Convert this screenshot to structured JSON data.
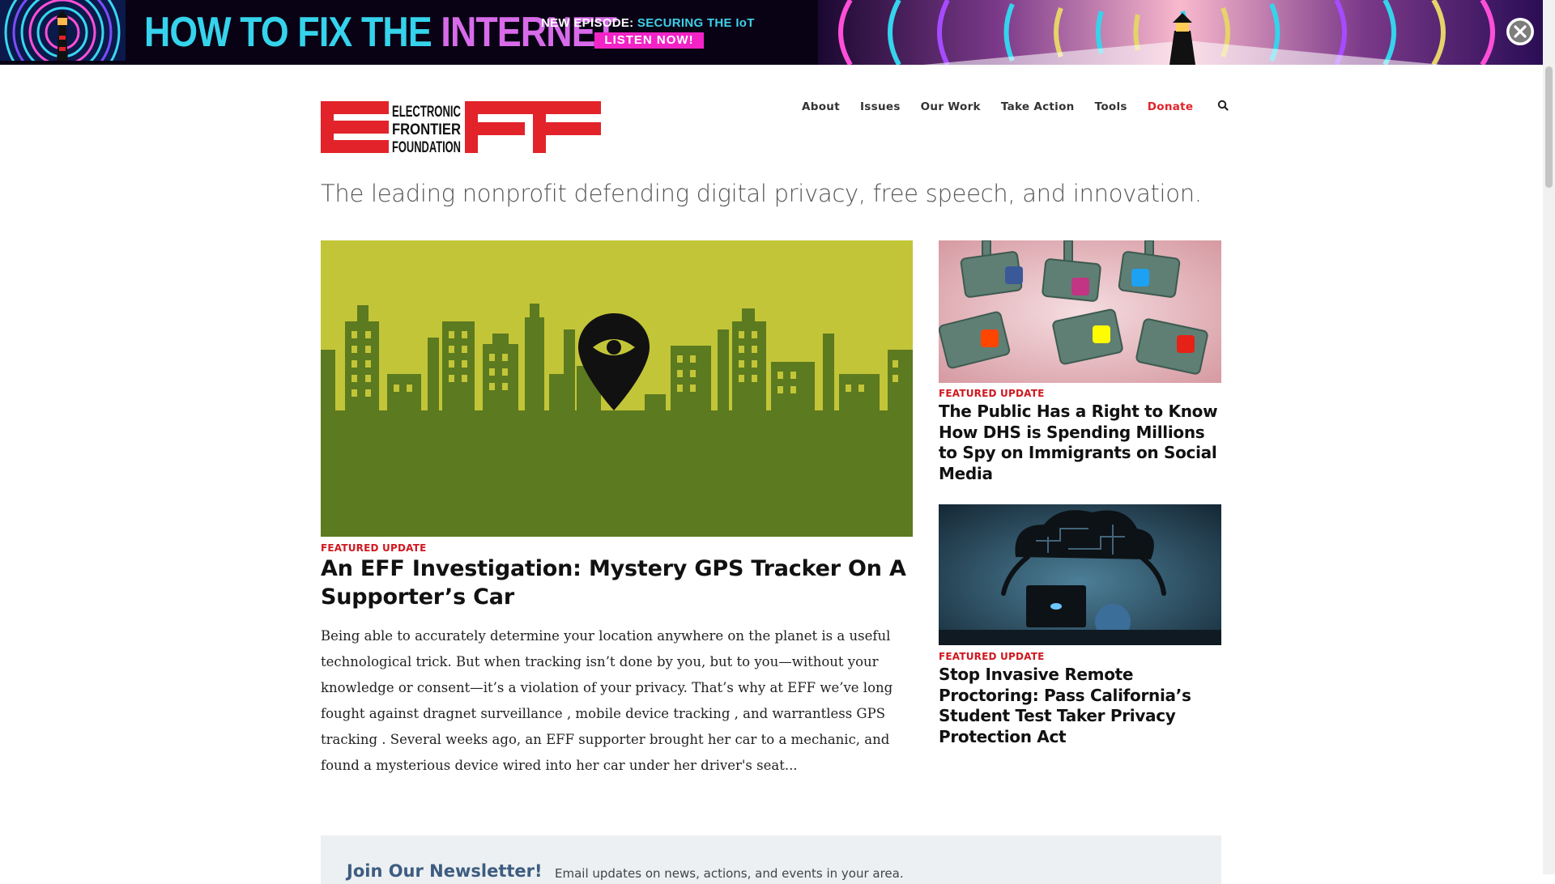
{
  "banner": {
    "title_part1": "HOW TO FIX THE ",
    "title_part2": "INTERNET",
    "episode_label": "NEW EPISODE: ",
    "episode_name": "SECURING THE IoT",
    "cta": "LISTEN NOW!"
  },
  "nav": {
    "items": [
      "About",
      "Issues",
      "Our Work",
      "Take Action",
      "Tools"
    ],
    "donate": "Donate"
  },
  "logo": {
    "text_lines": [
      "ELECTRONIC",
      "FRONTIER",
      "FOUNDATION"
    ],
    "brand_red": "#e2232a"
  },
  "tagline": "The leading nonprofit defending digital privacy, free speech, and innovation.",
  "feature": {
    "kicker": "FEATURED UPDATE",
    "headline": "An EFF Investigation: Mystery GPS Tracker On A Supporter’s Car",
    "body": "Being able to accurately determine your location anywhere on the planet is a useful technological trick. But when tracking isn’t done by you, but to you—without your knowledge or consent—it’s a violation of your privacy. That’s why at EFF we’ve long fought against dragnet surveillance , mobile device tracking , and warrantless GPS tracking . Several weeks ago, an EFF supporter brought her car to a mechanic, and found a mysterious device wired into her car under her driver's seat..."
  },
  "sidebar": [
    {
      "kicker": "FEATURED UPDATE",
      "headline": "The Public Has a Right to Know How DHS is Spending Millions to Spy on Immigrants on Social Media"
    },
    {
      "kicker": "FEATURED UPDATE",
      "headline": "Stop Invasive Remote Proctoring: Pass California’s Student Test Taker Privacy Protection Act"
    }
  ],
  "newsletter": {
    "title": "Join Our Newsletter!",
    "description": "Email updates on news, actions, and events in your area."
  },
  "icons": [
    "close-icon",
    "search-icon",
    "lighthouse-icon",
    "location-eye-icon"
  ]
}
